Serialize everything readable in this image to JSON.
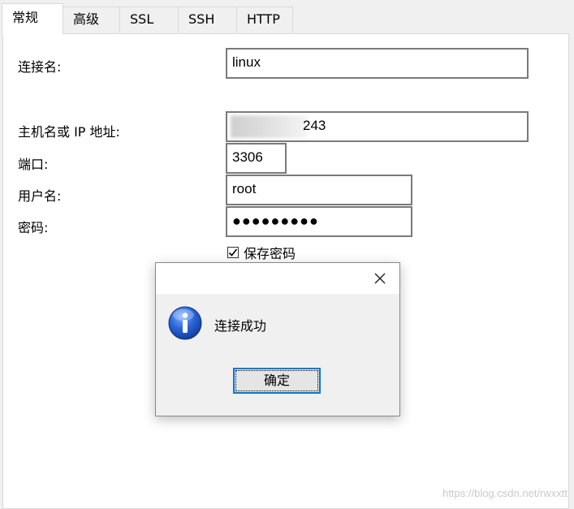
{
  "tabs": [
    {
      "label": "常规",
      "active": true
    },
    {
      "label": "高级",
      "active": false
    },
    {
      "label": "SSL",
      "active": false
    },
    {
      "label": "SSH",
      "active": false
    },
    {
      "label": "HTTP",
      "active": false
    }
  ],
  "form": {
    "connection_name_label": "连接名:",
    "connection_name_value": "linux",
    "host_label": "主机名或 IP 地址:",
    "host_value_visible": "243",
    "port_label": "端口:",
    "port_value": "3306",
    "username_label": "用户名:",
    "username_value": "root",
    "password_label": "密码:",
    "password_masked": "●●●●●●●●●",
    "save_password_label": "保存密码",
    "save_password_checked": true
  },
  "dialog": {
    "message": "连接成功",
    "ok_label": "确定",
    "icon": "info-icon",
    "close_icon": "close-icon"
  },
  "watermark": "https://blog.csdn.net/rwxxtt",
  "colors": {
    "focus_border": "#0078d7",
    "info_icon": "#1f57c3"
  }
}
